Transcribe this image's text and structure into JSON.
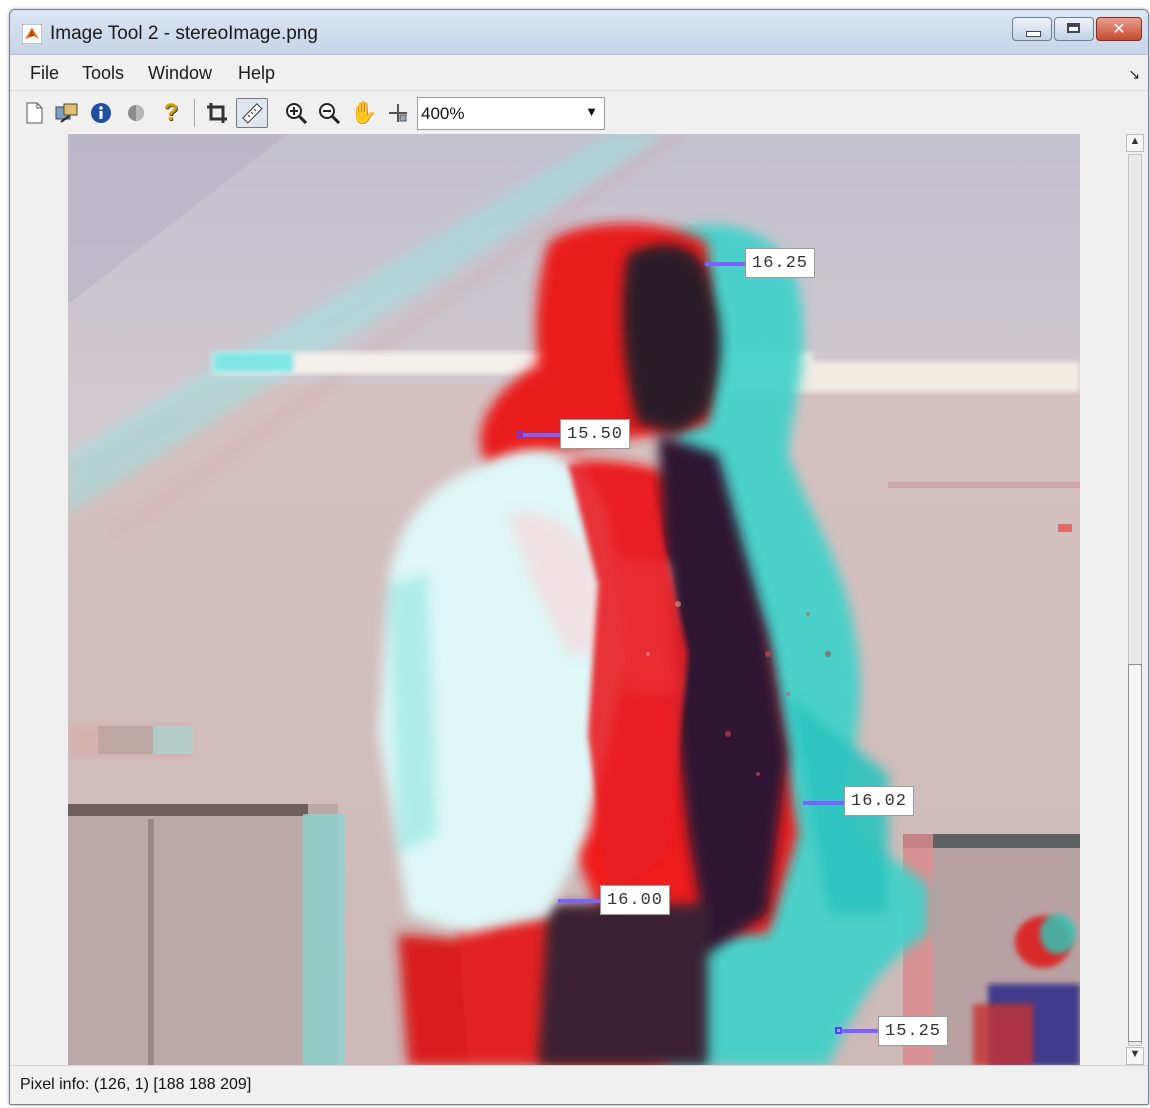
{
  "window": {
    "title": "Image Tool 2 - stereoImage.png",
    "app_icon": "matlab-icon",
    "close_label": "✕"
  },
  "menu": {
    "items": [
      "File",
      "Tools",
      "Window",
      "Help"
    ]
  },
  "toolbar": {
    "icons": [
      "new-figure-icon",
      "export-image-icon",
      "image-info-icon",
      "adjust-contrast-icon",
      "help-icon",
      "crop-icon",
      "distance-tool-icon",
      "zoom-in-icon",
      "zoom-out-icon",
      "pan-icon",
      "pixel-region-icon"
    ],
    "zoom_value": "400%"
  },
  "measurements": [
    "16.25",
    "15.50",
    "16.02",
    "16.00",
    "15.25"
  ],
  "status": {
    "pixel_info": "Pixel info: (126, 1)  [188 188 209]"
  },
  "colors": {
    "title_bar": "#c6d5e8",
    "measure_line": "#7a62ff",
    "anaglyph_red": "#ee1c1c",
    "anaglyph_cyan": "#3fd3cb"
  }
}
